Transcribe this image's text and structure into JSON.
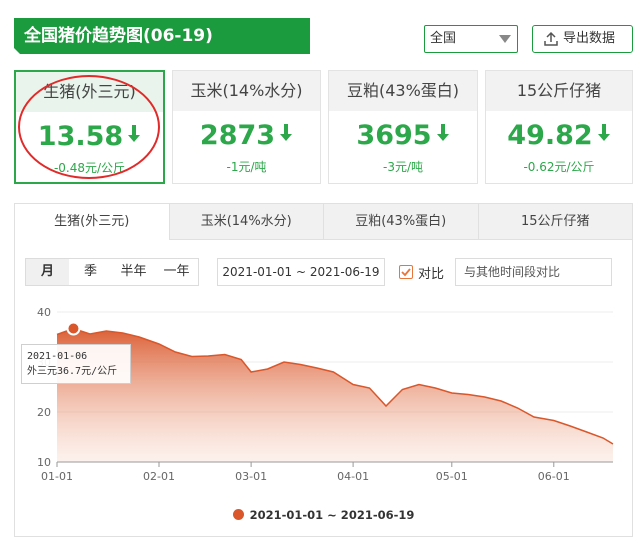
{
  "header": {
    "title": "全国猪价趋势图(06-19)",
    "region_selected": "全国",
    "export_label": "导出数据"
  },
  "cards": [
    {
      "name": "生猪(外三元)",
      "value": "13.58",
      "change": "-0.48元/公斤",
      "active": true
    },
    {
      "name": "玉米(14%水分)",
      "value": "2873",
      "change": "-1元/吨",
      "active": false
    },
    {
      "name": "豆粕(43%蛋白)",
      "value": "3695",
      "change": "-3元/吨",
      "active": false
    },
    {
      "name": "15公斤仔猪",
      "value": "49.82",
      "change": "-0.62元/公斤",
      "active": false
    }
  ],
  "tabs": [
    "生猪(外三元)",
    "玉米(14%水分)",
    "豆粕(43%蛋白)",
    "15公斤仔猪"
  ],
  "controls": {
    "periods": [
      "月",
      "季",
      "半年",
      "一年"
    ],
    "date_range": "2021-01-01 ~ 2021-06-19",
    "compare_label": "对比",
    "compare_checked": true,
    "compare_placeholder": "与其他时间段对比"
  },
  "tooltip": {
    "date": "2021-01-06",
    "text": "外三元36.7元/公斤"
  },
  "colors": {
    "brand_green": "#1c9a3e",
    "value_green": "#2ca74a",
    "series_orange": "#d9572b",
    "highlight_red": "#e12a2a"
  },
  "chart_data": {
    "type": "area",
    "yticks": [
      10,
      20,
      30,
      40
    ],
    "ylim": [
      10,
      40
    ],
    "xtick_labels": [
      "01-01",
      "02-01",
      "03-01",
      "04-01",
      "05-01",
      "06-01"
    ],
    "xtick_dates": [
      "2021-01-01",
      "2021-02-01",
      "2021-03-01",
      "2021-04-01",
      "2021-05-01",
      "2021-06-01"
    ],
    "legend": "2021-01-01 ~ 2021-06-19",
    "series": [
      {
        "name": "2021-01-01 ~ 2021-06-19",
        "x": [
          "2021-01-01",
          "2021-01-06",
          "2021-01-11",
          "2021-01-16",
          "2021-01-21",
          "2021-01-26",
          "2021-02-01",
          "2021-02-06",
          "2021-02-11",
          "2021-02-16",
          "2021-02-21",
          "2021-02-26",
          "2021-03-01",
          "2021-03-06",
          "2021-03-11",
          "2021-03-16",
          "2021-03-21",
          "2021-03-26",
          "2021-04-01",
          "2021-04-06",
          "2021-04-11",
          "2021-04-16",
          "2021-04-21",
          "2021-04-26",
          "2021-05-01",
          "2021-05-06",
          "2021-05-11",
          "2021-05-16",
          "2021-05-21",
          "2021-05-26",
          "2021-06-01",
          "2021-06-06",
          "2021-06-11",
          "2021-06-16",
          "2021-06-19"
        ],
        "y": [
          35.5,
          36.7,
          35.6,
          36.2,
          35.8,
          35.0,
          33.6,
          32.0,
          31.1,
          31.2,
          31.5,
          30.5,
          28.0,
          28.6,
          30.0,
          29.5,
          28.8,
          28.0,
          25.5,
          24.8,
          21.2,
          24.5,
          25.5,
          24.8,
          23.8,
          23.5,
          23.0,
          22.2,
          20.8,
          19.0,
          18.3,
          17.2,
          16.0,
          14.8,
          13.6
        ]
      }
    ]
  }
}
